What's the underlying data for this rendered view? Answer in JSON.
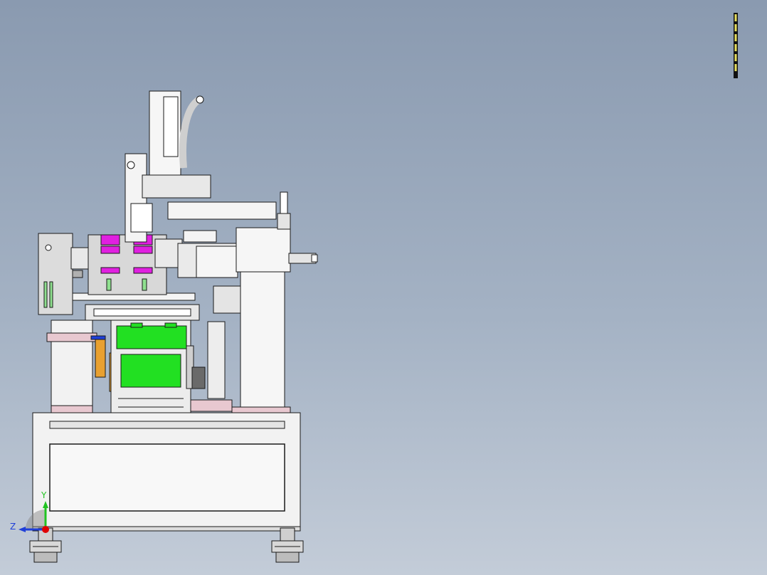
{
  "viewport": {
    "background_top": "#8a9ab0",
    "background_bottom": "#c3ccd8"
  },
  "triad": {
    "y_label": "Y",
    "z_label": "Z",
    "y_color": "#22c422",
    "z_color": "#1f3fd8",
    "origin_color": "#e00000"
  },
  "palette": {
    "frame": "#f2f2f2",
    "edge": "#1a1a1a",
    "motor_green": "#22e022",
    "gripper_magenta": "#e020e0",
    "spring_orange": "#e8a030",
    "base_pink": "#e8c8d0"
  },
  "icons": [
    "coordinate-triad-icon",
    "scale-bar-icon"
  ]
}
